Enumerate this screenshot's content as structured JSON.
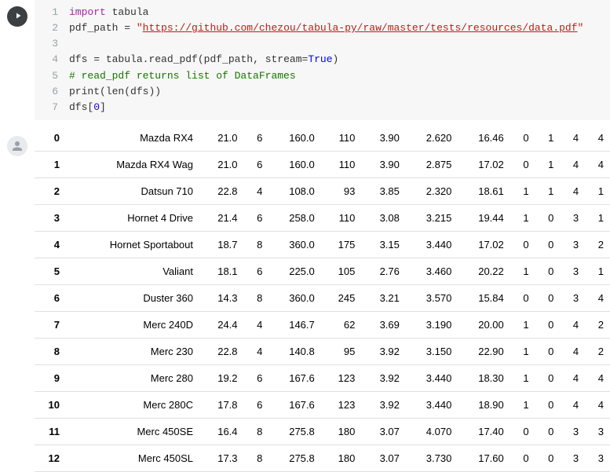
{
  "code": {
    "lines": [
      {
        "n": "1",
        "tokens": [
          {
            "t": "import ",
            "c": "tok-kw"
          },
          {
            "t": "tabula",
            "c": "tok-mod"
          }
        ]
      },
      {
        "n": "2",
        "tokens": [
          {
            "t": "pdf_path ",
            "c": "tok-id"
          },
          {
            "t": "= ",
            "c": "tok-op"
          },
          {
            "t": "\"",
            "c": "tok-str"
          },
          {
            "t": "https://github.com/chezou/tabula-py/raw/master/tests/resources/data.pdf",
            "c": "tok-url"
          },
          {
            "t": "\"",
            "c": "tok-str"
          }
        ]
      },
      {
        "n": "3",
        "tokens": []
      },
      {
        "n": "4",
        "tokens": [
          {
            "t": "dfs ",
            "c": "tok-id"
          },
          {
            "t": "= ",
            "c": "tok-op"
          },
          {
            "t": "tabula",
            "c": "tok-id"
          },
          {
            "t": ".",
            "c": "tok-op"
          },
          {
            "t": "read_pdf",
            "c": "tok-fn"
          },
          {
            "t": "(pdf_path, stream=",
            "c": "tok-op"
          },
          {
            "t": "True",
            "c": "tok-kwblue"
          },
          {
            "t": ")",
            "c": "tok-op"
          }
        ]
      },
      {
        "n": "5",
        "tokens": [
          {
            "t": "# read_pdf returns list of DataFrames",
            "c": "tok-comment"
          }
        ]
      },
      {
        "n": "6",
        "tokens": [
          {
            "t": "print",
            "c": "tok-fn"
          },
          {
            "t": "(",
            "c": "tok-op"
          },
          {
            "t": "len",
            "c": "tok-fn"
          },
          {
            "t": "(dfs))",
            "c": "tok-op"
          }
        ]
      },
      {
        "n": "7",
        "tokens": [
          {
            "t": "dfs[",
            "c": "tok-id"
          },
          {
            "t": "0",
            "c": "tok-num"
          },
          {
            "t": "]",
            "c": "tok-id"
          }
        ]
      }
    ]
  },
  "table": {
    "rows": [
      {
        "idx": "0",
        "name": "Mazda RX4",
        "c": [
          "21.0",
          "6",
          "160.0",
          "110",
          "3.90",
          "2.620",
          "16.46",
          "0",
          "1",
          "4",
          "4"
        ]
      },
      {
        "idx": "1",
        "name": "Mazda RX4 Wag",
        "c": [
          "21.0",
          "6",
          "160.0",
          "110",
          "3.90",
          "2.875",
          "17.02",
          "0",
          "1",
          "4",
          "4"
        ]
      },
      {
        "idx": "2",
        "name": "Datsun 710",
        "c": [
          "22.8",
          "4",
          "108.0",
          "93",
          "3.85",
          "2.320",
          "18.61",
          "1",
          "1",
          "4",
          "1"
        ]
      },
      {
        "idx": "3",
        "name": "Hornet 4 Drive",
        "c": [
          "21.4",
          "6",
          "258.0",
          "110",
          "3.08",
          "3.215",
          "19.44",
          "1",
          "0",
          "3",
          "1"
        ]
      },
      {
        "idx": "4",
        "name": "Hornet Sportabout",
        "c": [
          "18.7",
          "8",
          "360.0",
          "175",
          "3.15",
          "3.440",
          "17.02",
          "0",
          "0",
          "3",
          "2"
        ]
      },
      {
        "idx": "5",
        "name": "Valiant",
        "c": [
          "18.1",
          "6",
          "225.0",
          "105",
          "2.76",
          "3.460",
          "20.22",
          "1",
          "0",
          "3",
          "1"
        ]
      },
      {
        "idx": "6",
        "name": "Duster 360",
        "c": [
          "14.3",
          "8",
          "360.0",
          "245",
          "3.21",
          "3.570",
          "15.84",
          "0",
          "0",
          "3",
          "4"
        ]
      },
      {
        "idx": "7",
        "name": "Merc 240D",
        "c": [
          "24.4",
          "4",
          "146.7",
          "62",
          "3.69",
          "3.190",
          "20.00",
          "1",
          "0",
          "4",
          "2"
        ]
      },
      {
        "idx": "8",
        "name": "Merc 230",
        "c": [
          "22.8",
          "4",
          "140.8",
          "95",
          "3.92",
          "3.150",
          "22.90",
          "1",
          "0",
          "4",
          "2"
        ]
      },
      {
        "idx": "9",
        "name": "Merc 280",
        "c": [
          "19.2",
          "6",
          "167.6",
          "123",
          "3.92",
          "3.440",
          "18.30",
          "1",
          "0",
          "4",
          "4"
        ]
      },
      {
        "idx": "10",
        "name": "Merc 280C",
        "c": [
          "17.8",
          "6",
          "167.6",
          "123",
          "3.92",
          "3.440",
          "18.90",
          "1",
          "0",
          "4",
          "4"
        ]
      },
      {
        "idx": "11",
        "name": "Merc 450SE",
        "c": [
          "16.4",
          "8",
          "275.8",
          "180",
          "3.07",
          "4.070",
          "17.40",
          "0",
          "0",
          "3",
          "3"
        ]
      },
      {
        "idx": "12",
        "name": "Merc 450SL",
        "c": [
          "17.3",
          "8",
          "275.8",
          "180",
          "3.07",
          "3.730",
          "17.60",
          "0",
          "0",
          "3",
          "3"
        ]
      }
    ]
  }
}
